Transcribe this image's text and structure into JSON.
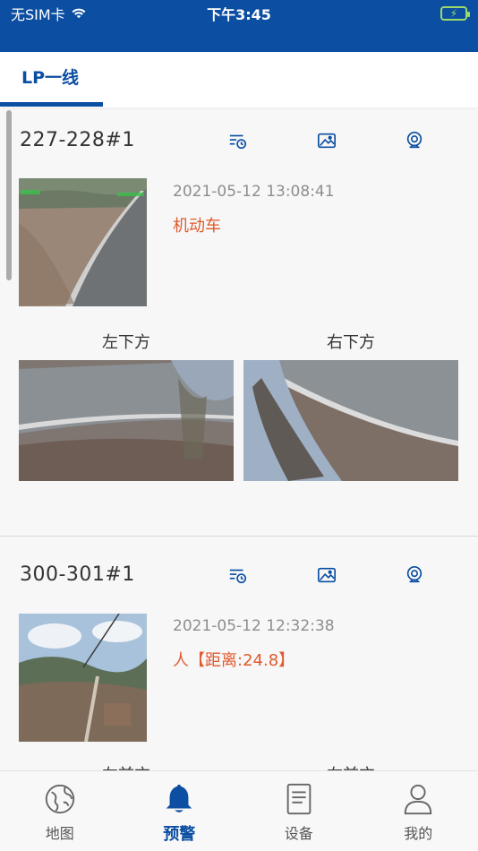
{
  "status_bar": {
    "carrier": "无SIM卡",
    "time": "下午3:45"
  },
  "tabs": [
    {
      "label": "LP一线",
      "active": true
    }
  ],
  "colors": {
    "primary": "#0b4ea2",
    "alarm": "#e05a2d"
  },
  "alerts": [
    {
      "title": "227-228#1",
      "timestamp": "2021-05-12 13:08:41",
      "type": "机动车",
      "icons": [
        "history-icon",
        "image-icon",
        "camera-icon"
      ],
      "cameras": [
        {
          "label": "左下方"
        },
        {
          "label": "右下方"
        }
      ]
    },
    {
      "title": "300-301#1",
      "timestamp": "2021-05-12 12:32:38",
      "type": "人【距离:24.8】",
      "icons": [
        "history-icon",
        "image-icon",
        "camera-icon"
      ],
      "cameras": [
        {
          "label": "左前方"
        },
        {
          "label": "右前方"
        }
      ]
    }
  ],
  "bottom_nav": [
    {
      "label": "地图",
      "icon": "globe-icon",
      "active": false
    },
    {
      "label": "预警",
      "icon": "bell-icon",
      "active": true
    },
    {
      "label": "设备",
      "icon": "clipboard-icon",
      "active": false
    },
    {
      "label": "我的",
      "icon": "user-icon",
      "active": false
    }
  ]
}
